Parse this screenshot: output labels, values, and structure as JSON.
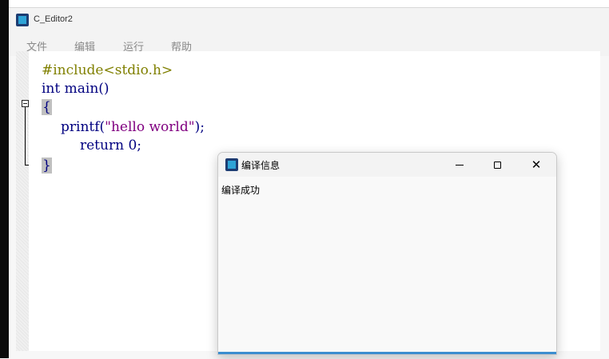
{
  "window": {
    "title": "C_Editor2"
  },
  "menu": {
    "items": [
      "文件",
      "编辑",
      "运行",
      "帮助"
    ]
  },
  "editor": {
    "lines": {
      "l1": "#include<stdio.h>",
      "l2_kw": "int",
      "l2_rest": " main()",
      "l3": "{",
      "l4_fn": "printf(",
      "l4_str": "\"hello world\"",
      "l4_end": ");",
      "l5_kw": "return",
      "l5_rest": " 0;",
      "l6": "}"
    }
  },
  "dialog": {
    "title": "编译信息",
    "message": "编译成功",
    "close_glyph": "✕"
  },
  "icons": [
    "app-icon",
    "fold-minus-icon",
    "minimize-icon",
    "maximize-icon",
    "close-icon"
  ]
}
